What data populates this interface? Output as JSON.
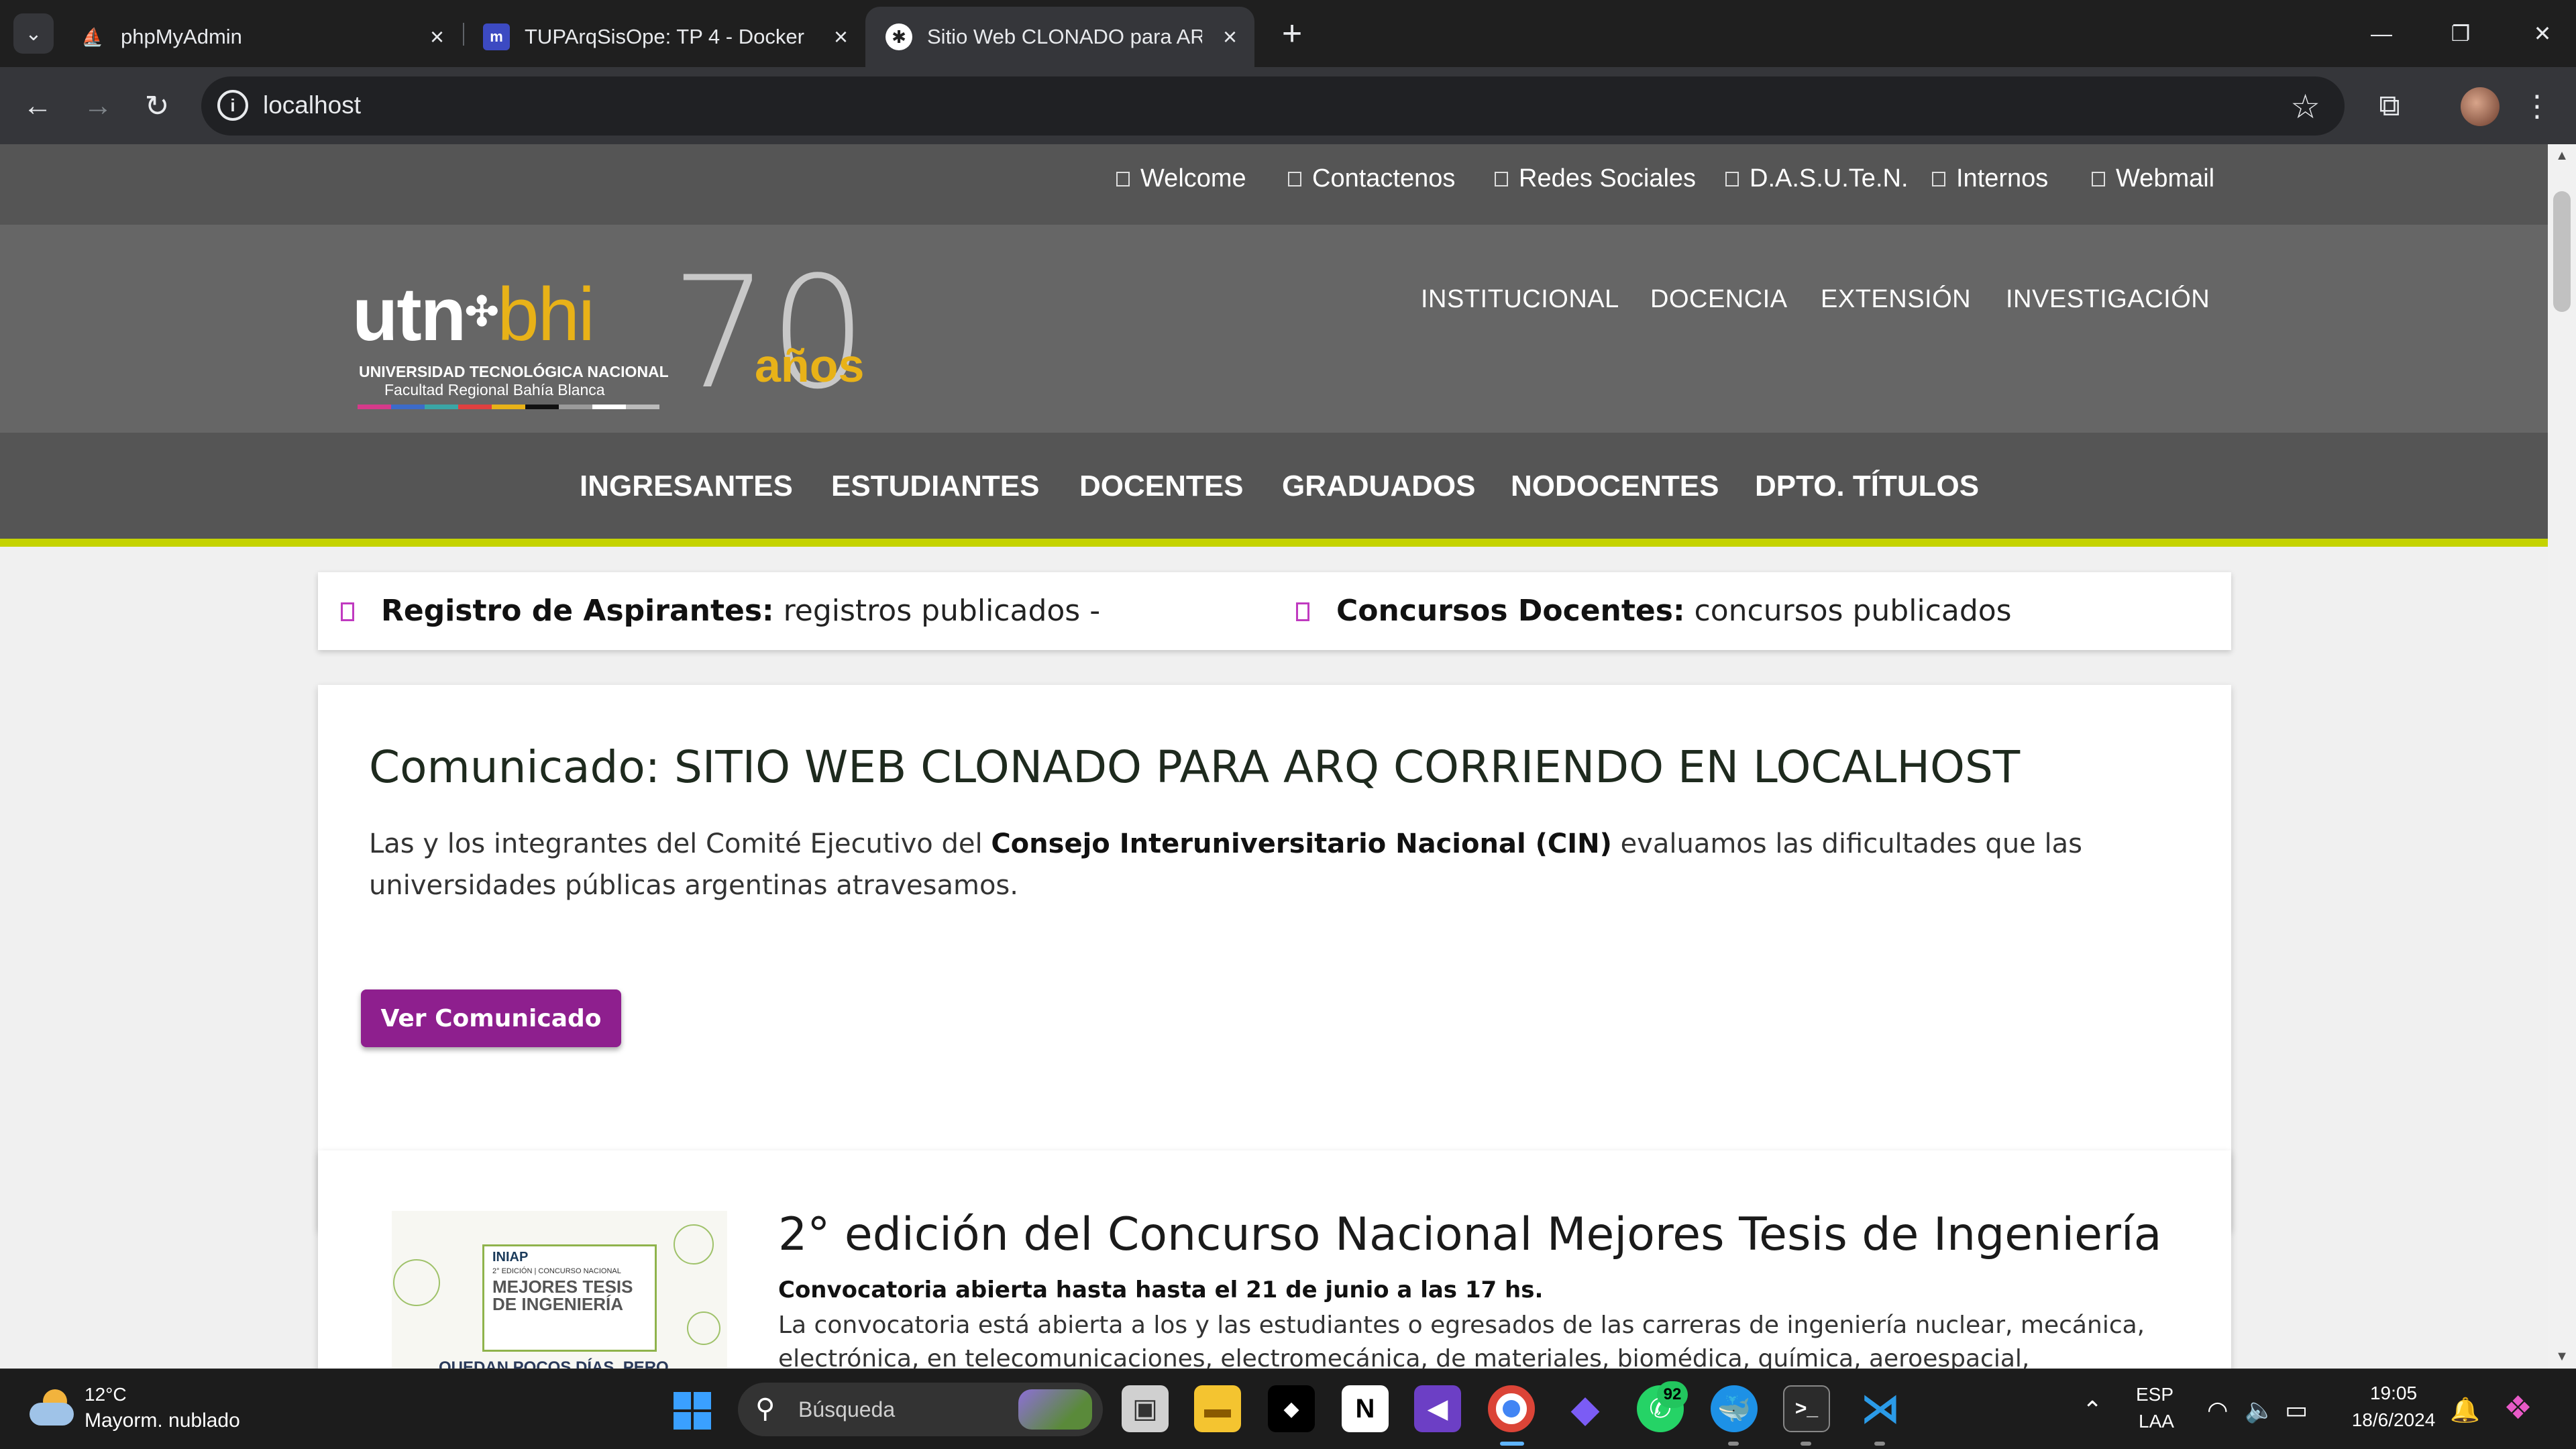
{
  "browser": {
    "tabs": [
      {
        "title": "phpMyAdmin",
        "favicon": "phpmyadmin-icon"
      },
      {
        "title": "TUPArqSisOpe: TP 4 - Docker",
        "favicon": "moodle-icon"
      },
      {
        "title": "Sitio Web CLONADO para ARQ",
        "favicon": "utn-icon",
        "active": true
      }
    ],
    "url": "localhost"
  },
  "topnav": {
    "links": [
      "Welcome",
      "Contactenos",
      "Redes Sociales",
      "D.A.S.U.Te.N.",
      "Internos",
      "Webmail"
    ]
  },
  "header": {
    "logo": {
      "utn": "utn",
      "bhi": "bhi",
      "line1": "UNIVERSIDAD TECNOLÓGICA NACIONAL",
      "line2": "Facultad Regional Bahía Blanca",
      "seventy": "70",
      "anos": "años"
    },
    "menu": [
      "INSTITUCIONAL",
      "DOCENCIA",
      "EXTENSIÓN",
      "INVESTIGACIÓN"
    ]
  },
  "secnav": {
    "items": [
      "INGRESANTES",
      "ESTUDIANTES",
      "DOCENTES",
      "GRADUADOS",
      "NODOCENTES",
      "DPTO. TÍTULOS"
    ]
  },
  "ticker": {
    "item1": {
      "label": "Registro de Aspirantes:",
      "text": "registros publicados -"
    },
    "item2": {
      "label": "Concursos Docentes:",
      "text": "concursos publicados"
    }
  },
  "comunicado": {
    "title": "Comunicado: SITIO WEB CLONADO PARA ARQ CORRIENDO EN LOCALHOST",
    "body_pre": "Las y los integrantes del Comité Ejecutivo del ",
    "body_bold": "Consejo Interuniversitario Nacional (CIN)",
    "body_post": " evaluamos las dificultades que las universidades públicas argentinas atravesamos.",
    "button": "Ver Comunicado"
  },
  "concurso": {
    "title": "2° edición del Concurso Nacional Mejores Tesis de Ingeniería",
    "subtitle": "Convocatoria abierta hasta hasta el 21 de junio a las 17 hs.",
    "body": "La convocatoria está abierta a los y las estudiantes o egresados de las carreras de ingeniería nuclear, mecánica, electrónica, en telecomunicaciones, electromecánica, de materiales, biomédica, química, aeroespacial, mecatrónica, aeronáutica, industrial e",
    "image": {
      "brand": "INIAP",
      "edition": "2° EDICIÓN | CONCURSO NACIONAL",
      "heading": "MEJORES TESIS DE INGENIERÍA",
      "footer": "QUEDAN POCOS DÍAS, PERO"
    }
  },
  "taskbar": {
    "weather_temp": "12°C",
    "weather_desc": "Mayorm. nublado",
    "search_placeholder": "Búsqueda",
    "whatsapp_badge": "92",
    "lang": "ESP",
    "layout": "LAA",
    "time": "19:05",
    "date": "18/6/2024"
  },
  "colors": {
    "accent_purple": "#8e1f8e",
    "nav_lime": "#c5d300",
    "utn_yellow": "#e8b218"
  }
}
